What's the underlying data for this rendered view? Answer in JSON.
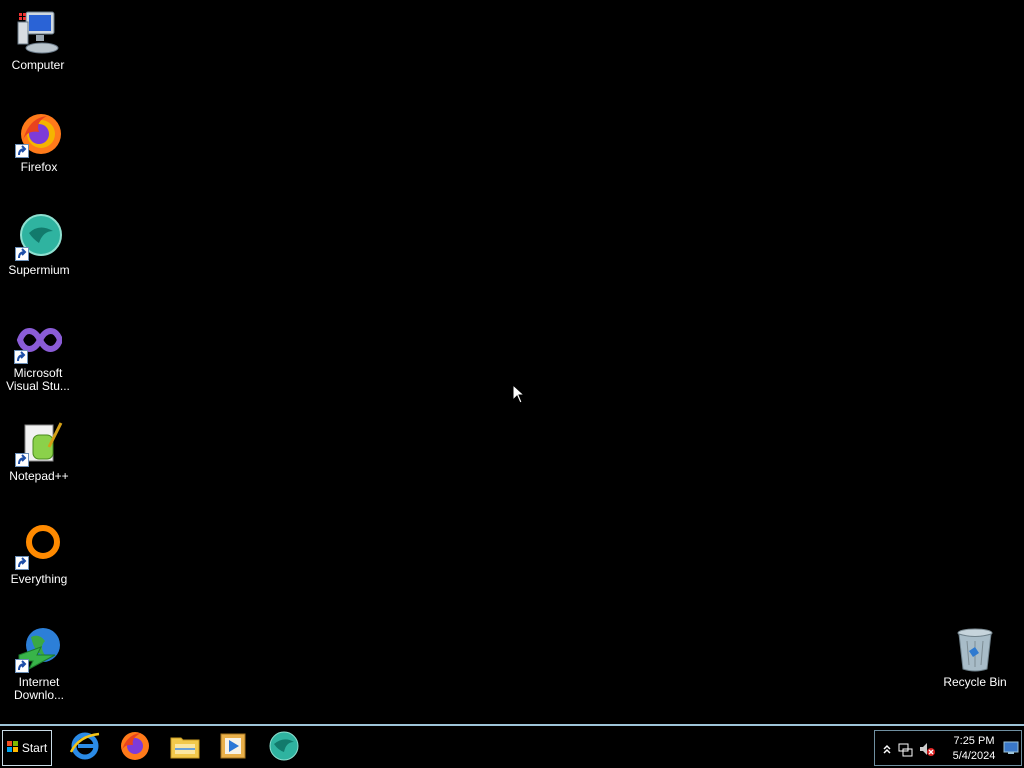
{
  "desktop": {
    "icons": [
      {
        "label": "Computer",
        "icon": "computer-icon"
      },
      {
        "label": "Firefox",
        "icon": "firefox-icon"
      },
      {
        "label": "Supermium",
        "icon": "supermium-icon"
      },
      {
        "label": "Microsoft Visual Stu...",
        "icon": "visual-studio-icon"
      },
      {
        "label": "Notepad++",
        "icon": "notepad-plus-plus-icon"
      },
      {
        "label": "Everything",
        "icon": "everything-icon"
      },
      {
        "label": "Internet Downlo...",
        "icon": "internet-download-manager-icon"
      },
      {
        "label": "Recycle Bin",
        "icon": "recycle-bin-icon"
      }
    ]
  },
  "taskbar": {
    "start_label": "Start",
    "pinned": [
      "internet-explorer-icon",
      "firefox-icon",
      "file-explorer-icon",
      "media-player-icon",
      "supermium-icon"
    ],
    "clock": {
      "time": "7:25 PM",
      "date": "5/4/2024"
    }
  },
  "colors": {
    "desktop_bg": "#000000",
    "taskbar_border": "#9ec4d8"
  }
}
